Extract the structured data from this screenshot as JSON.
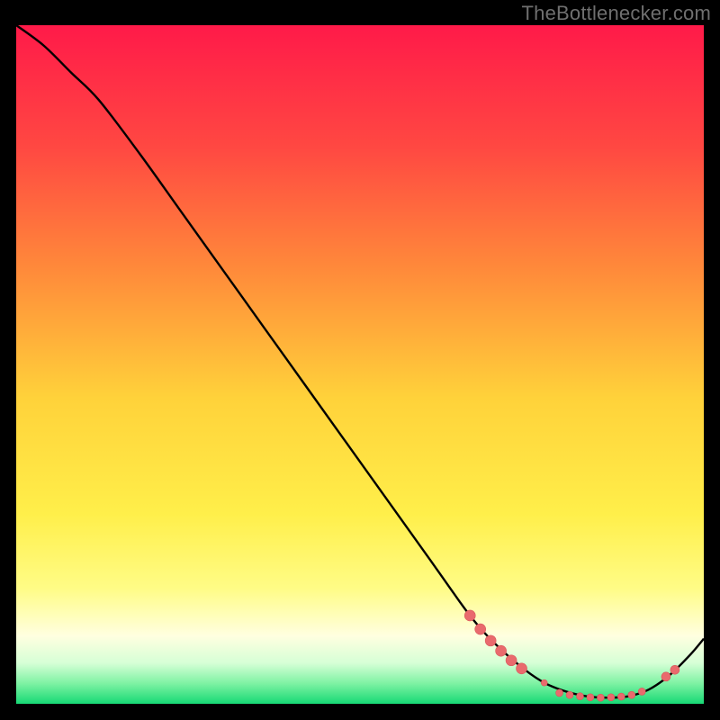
{
  "attribution": "TheBottlenecker.com",
  "colors": {
    "bg": "#000000",
    "curve": "#000000",
    "marker_fill": "#e96a6d",
    "marker_stroke": "#d9575b",
    "attribution_text": "#6f6f6f"
  },
  "chart_data": {
    "type": "line",
    "title": "",
    "xlabel": "",
    "ylabel": "",
    "xlim": [
      0,
      100
    ],
    "ylim": [
      0,
      100
    ],
    "background_gradient": {
      "direction": "vertical",
      "stops": [
        {
          "offset": 0.0,
          "color": "#ff1a49"
        },
        {
          "offset": 0.18,
          "color": "#ff4842"
        },
        {
          "offset": 0.36,
          "color": "#ff8a3a"
        },
        {
          "offset": 0.55,
          "color": "#ffd23a"
        },
        {
          "offset": 0.72,
          "color": "#ffef4a"
        },
        {
          "offset": 0.83,
          "color": "#fffc86"
        },
        {
          "offset": 0.9,
          "color": "#ffffe0"
        },
        {
          "offset": 0.94,
          "color": "#d6ffd6"
        },
        {
          "offset": 0.97,
          "color": "#7ef2a3"
        },
        {
          "offset": 1.0,
          "color": "#17d975"
        }
      ]
    },
    "series": [
      {
        "name": "bottleneck-curve",
        "x": [
          0,
          4,
          8,
          12,
          18,
          24,
          30,
          36,
          42,
          48,
          54,
          60,
          66,
          70,
          74,
          77,
          80,
          83,
          86,
          89,
          92,
          95,
          98,
          100
        ],
        "y": [
          100,
          97,
          93,
          89,
          81,
          72.5,
          64,
          55.5,
          47,
          38.5,
          30,
          21.5,
          13,
          8.5,
          5,
          3,
          1.8,
          1.1,
          0.9,
          1.1,
          2.1,
          4.2,
          7.2,
          9.6
        ]
      }
    ],
    "markers": [
      {
        "x": 66,
        "y": 13,
        "r": 6
      },
      {
        "x": 67.5,
        "y": 11,
        "r": 6
      },
      {
        "x": 69,
        "y": 9.3,
        "r": 6
      },
      {
        "x": 70.5,
        "y": 7.8,
        "r": 6
      },
      {
        "x": 72,
        "y": 6.4,
        "r": 6
      },
      {
        "x": 73.5,
        "y": 5.2,
        "r": 6
      },
      {
        "x": 76.8,
        "y": 3.1,
        "r": 3.5
      },
      {
        "x": 79,
        "y": 1.6,
        "r": 4
      },
      {
        "x": 80.5,
        "y": 1.3,
        "r": 4
      },
      {
        "x": 82,
        "y": 1.1,
        "r": 4
      },
      {
        "x": 83.5,
        "y": 0.95,
        "r": 4
      },
      {
        "x": 85,
        "y": 0.9,
        "r": 4
      },
      {
        "x": 86.5,
        "y": 0.95,
        "r": 4
      },
      {
        "x": 88,
        "y": 1.05,
        "r": 4
      },
      {
        "x": 89.5,
        "y": 1.3,
        "r": 4
      },
      {
        "x": 91,
        "y": 1.8,
        "r": 4
      },
      {
        "x": 94.5,
        "y": 4.0,
        "r": 5
      },
      {
        "x": 95.8,
        "y": 5.0,
        "r": 5
      }
    ]
  }
}
